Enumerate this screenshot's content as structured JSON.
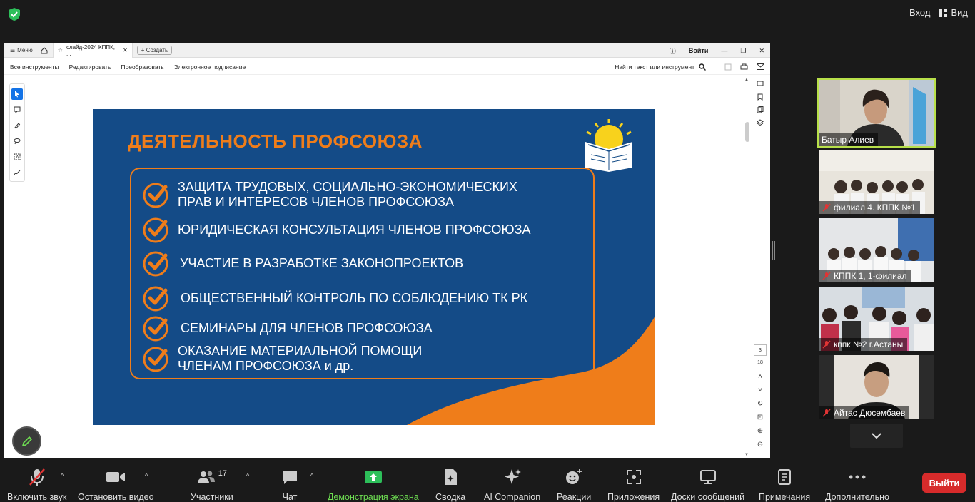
{
  "topbar": {
    "signin_label": "Вход",
    "view_label": "Вид"
  },
  "viewer": {
    "menu_label": "Меню",
    "tab_title": "слайд-2024 КППК, ...",
    "create_label": "Создать",
    "signin_label": "Войти",
    "tools": [
      "Все инструменты",
      "Редактировать",
      "Преобразовать",
      "Электронное подписание"
    ],
    "find_label": "Найти текст или инструмент",
    "page_current": "3",
    "page_total": "18"
  },
  "slide": {
    "title": "ДЕЯТЕЛЬНОСТЬ ПРОФСОЮЗА",
    "items": [
      {
        "line1": "ЗАЩИТА ТРУДОВЫХ, СОЦИАЛЬНО-ЭКОНОМИЧЕСКИХ",
        "line2": "ПРАВ И ИНТЕРЕСОВ ЧЛЕНОВ ПРОФСОЮЗА"
      },
      {
        "line1": "ЮРИДИЧЕСКАЯ КОНСУЛЬТАЦИЯ ЧЛЕНОВ ПРОФСОЮЗА",
        "line2": ""
      },
      {
        "line1": "УЧАСТИЕ В РАЗРАБОТКЕ ЗАКОНОПРОЕКТОВ",
        "line2": ""
      },
      {
        "line1": "ОБЩЕСТВЕННЫЙ КОНТРОЛЬ ПО СОБЛЮДЕНИЮ ТК РК",
        "line2": ""
      },
      {
        "line1": "СЕМИНАРЫ ДЛЯ ЧЛЕНОВ ПРОФСОЮЗА",
        "line2": ""
      },
      {
        "line1": "ОКАЗАНИЕ МАТЕРИАЛЬНОЙ ПОМОЩИ",
        "line2": "ЧЛЕНАМ ПРОФСОЮЗА и др."
      }
    ],
    "accent_color": "#ef7d1a",
    "background_color": "#144b87"
  },
  "participants": [
    {
      "name": "Батыр Алиев",
      "muted": false,
      "active": true
    },
    {
      "name": "филиал 4. КППК №1",
      "muted": true
    },
    {
      "name": "КППК 1, 1-филиал",
      "muted": true
    },
    {
      "name": "кппк №2 г.Астаны",
      "muted": true
    },
    {
      "name": "Айтас Дюсембаев",
      "muted": true
    }
  ],
  "toolbar": {
    "unmute": "Включить звук",
    "stop_video": "Остановить видео",
    "participants": "Участники",
    "participants_count": "17",
    "chat": "Чат",
    "share_screen": "Демонстрация экрана",
    "summary": "Сводка",
    "ai_companion": "AI Companion",
    "reactions": "Реакции",
    "apps": "Приложения",
    "whiteboards": "Доски сообщений",
    "notes": "Примечания",
    "more": "Дополнительно",
    "leave": "Выйти"
  }
}
